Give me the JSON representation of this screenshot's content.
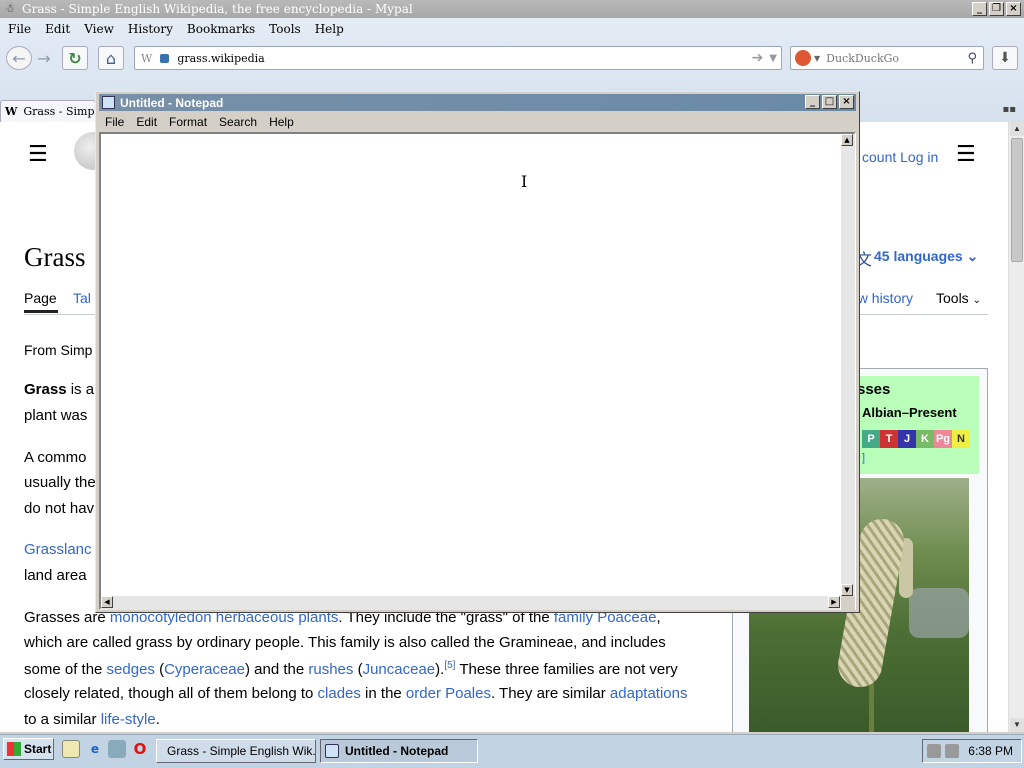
{
  "browser": {
    "title": "Grass - Simple English Wikipedia, the free encyclopedia - Mypal",
    "menu": [
      "File",
      "Edit",
      "View",
      "History",
      "Bookmarks",
      "Tools",
      "Help"
    ],
    "url": "grass.wikipedia",
    "url_favicon": "W",
    "search_placeholder": "DuckDuckGo",
    "tab_label": "Grass - Simple E",
    "tab_favicon": "W"
  },
  "page": {
    "header_links": "count   Log in",
    "title": "Grass",
    "tabs": {
      "page": "Page",
      "talk": "Tal",
      "view_history": "ew history",
      "tools": "Tools"
    },
    "languages": "45 languages",
    "from": "From Simp",
    "para1": {
      "bold": "Grass",
      "rest": " is a",
      "line2": "plant was"
    },
    "para2": [
      "A commo",
      "usually the",
      "do not hav"
    ],
    "para3": {
      "link": "Grasslanc",
      "line2": "land area"
    },
    "para4": {
      "l1_a": "Grasses are ",
      "l1_link1": "monocotyledon herbaceous plants",
      "l1_b": ". They include the \"grass\" of the ",
      "l1_link2": "family Poaceae",
      "l1_c": ",",
      "l2": "which are called grass by ordinary people. This family is also called the Gramineae, and includes",
      "l3_a": "some of the ",
      "l3_link1": "sedges",
      "l3_b": " (",
      "l3_link2": "Cyperaceae",
      "l3_c": ") and the ",
      "l3_link3": "rushes",
      "l3_d": " (",
      "l3_link4": "Juncaceae",
      "l3_e": ").",
      "l3_ref": "[5]",
      "l3_f": " These three families are not very",
      "l4_a": "closely related, though all of them belong to ",
      "l4_link1": "clades",
      "l4_b": " in the ",
      "l4_link2": "order Poales",
      "l4_c": ". They are similar ",
      "l4_link3": "adaptations",
      "l5_a": "to a similar ",
      "l5_link": "life-style",
      "l5_b": "."
    },
    "infobox": {
      "title": "sses",
      "range": "Albian–Present",
      "timeline": [
        "P",
        "T",
        "J",
        "K",
        "Pg",
        "N"
      ],
      "ref": "]"
    }
  },
  "notepad": {
    "title": "Untitled - Notepad",
    "menu": [
      "File",
      "Edit",
      "Format",
      "Search",
      "Help"
    ],
    "content": ""
  },
  "taskbar": {
    "start": "Start",
    "tasks": [
      "Grass - Simple English Wik...",
      "Untitled - Notepad"
    ],
    "clock": "6:38 PM"
  }
}
